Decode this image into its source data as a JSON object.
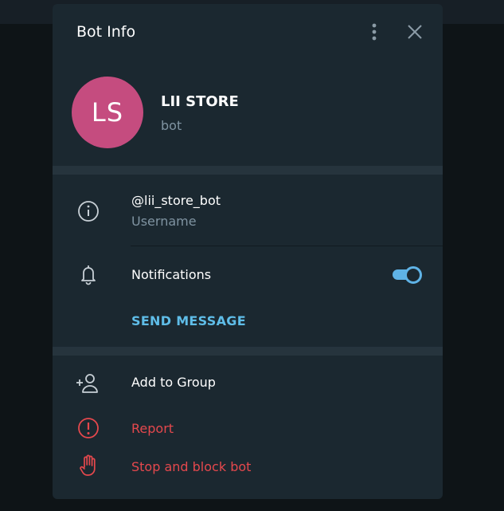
{
  "dialog": {
    "title": "Bot Info"
  },
  "profile": {
    "initials": "LS",
    "name": "LII STORE",
    "type": "bot",
    "avatar_color": "#c54c7f"
  },
  "info": {
    "username": "@lii_store_bot",
    "username_label": "Username",
    "notifications_label": "Notifications",
    "notifications_enabled": true,
    "send_message": "SEND MESSAGE"
  },
  "actions": {
    "add_to_group": "Add to Group",
    "report": "Report",
    "block": "Stop and block bot"
  },
  "colors": {
    "accent": "#5fbde8",
    "danger": "#e5484d",
    "background": "#1b2830"
  }
}
